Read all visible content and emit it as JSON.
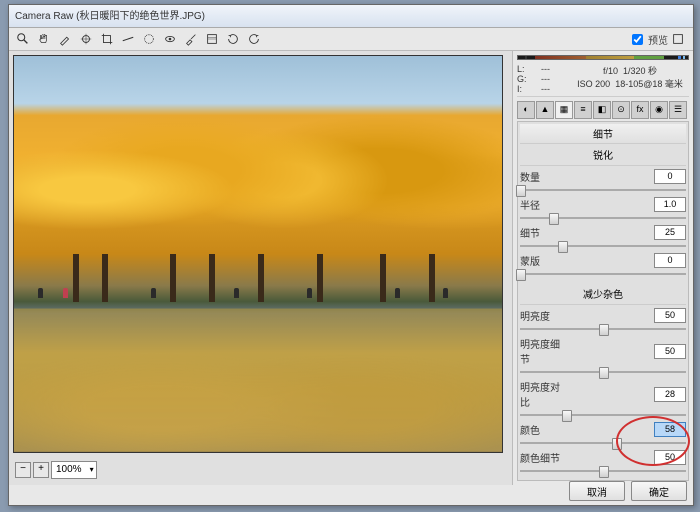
{
  "title": "Camera Raw (秋日暖阳下的绝色世界.JPG)",
  "preview_label": "预览",
  "zoom": {
    "value": "100%"
  },
  "meta": {
    "labels": [
      "L:",
      "G:",
      "I:"
    ],
    "vals": [
      "---",
      "---",
      "---"
    ],
    "aperture": "f/10",
    "shutter": "1/320 秒",
    "iso": "ISO 200",
    "lens": "18-105@18 毫米"
  },
  "section_header": "细节",
  "sharpen": {
    "title": "锐化",
    "rows": [
      {
        "label": "数量",
        "value": "0",
        "pos": 0
      },
      {
        "label": "半径",
        "value": "1.0",
        "pos": 20
      },
      {
        "label": "细节",
        "value": "25",
        "pos": 25
      },
      {
        "label": "蒙版",
        "value": "0",
        "pos": 0
      }
    ]
  },
  "noise": {
    "title": "减少杂色",
    "rows": [
      {
        "label": "明亮度",
        "value": "50",
        "pos": 50
      },
      {
        "label": "明亮度细节",
        "value": "50",
        "pos": 50
      },
      {
        "label": "明亮度对比",
        "value": "28",
        "pos": 28
      },
      {
        "label": "颜色",
        "value": "58",
        "pos": 58,
        "highlight": true
      },
      {
        "label": "颜色细节",
        "value": "50",
        "pos": 50
      }
    ]
  },
  "buttons": {
    "cancel": "取消",
    "ok": "确定"
  }
}
